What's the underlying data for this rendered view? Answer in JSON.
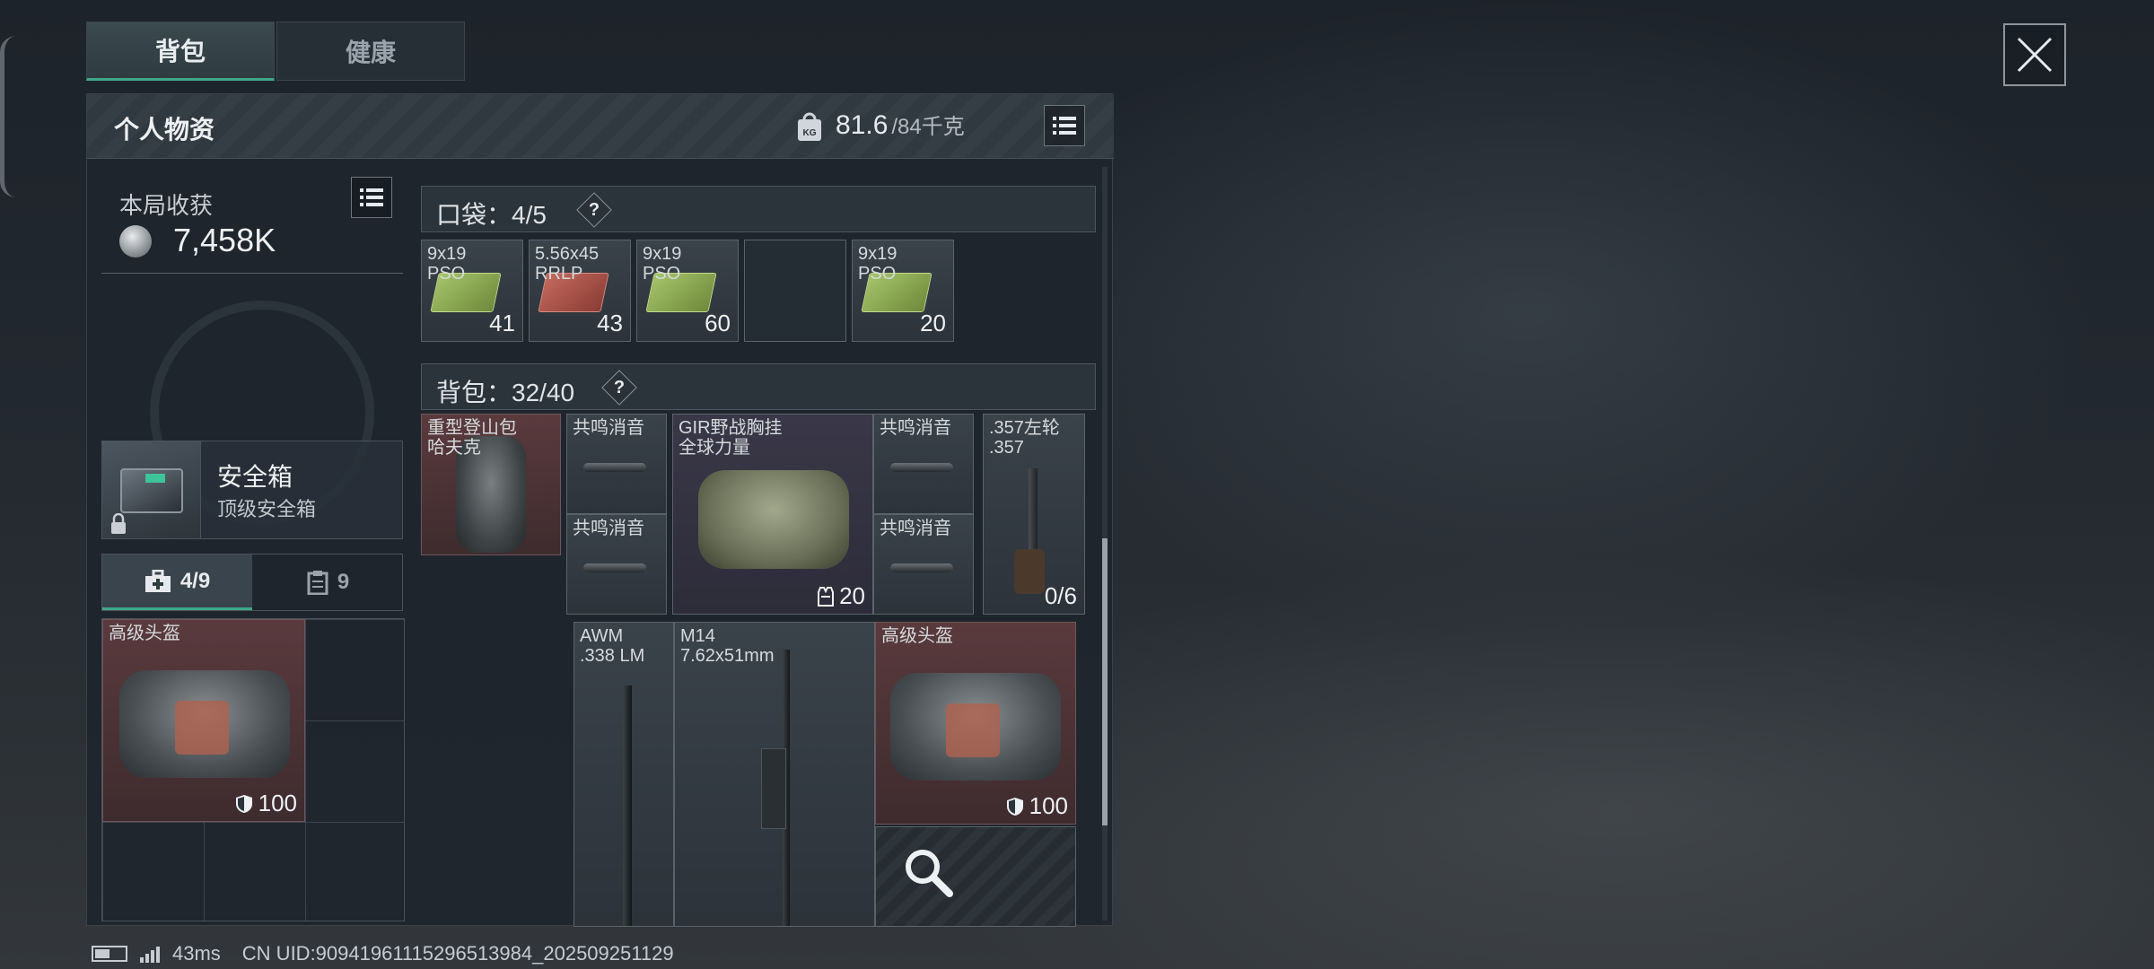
{
  "tabs": [
    {
      "label": "背包",
      "active": true
    },
    {
      "label": "健康",
      "active": false
    }
  ],
  "panel": {
    "title": "个人物资",
    "weight_current": "81.6",
    "weight_max": "/84千克",
    "weight_icon": "kg-weight-icon"
  },
  "earnings": {
    "label": "本局收获",
    "value": "7,458K"
  },
  "safe_box": {
    "title": "安全箱",
    "subtitle": "顶级安全箱"
  },
  "sub_tabs": [
    {
      "label": "4/9",
      "icon": "medkit-icon",
      "active": true
    },
    {
      "label": "9",
      "icon": "clipboard-icon",
      "active": false
    }
  ],
  "safe_items": [
    {
      "name": "高级头盔",
      "durability": "100"
    }
  ],
  "pockets": {
    "label": "口袋：4/5",
    "items": [
      {
        "name": "9x19\nPSO",
        "count": "41",
        "color": "green"
      },
      {
        "name": "5.56x45\nRRLP",
        "count": "43",
        "color": "red"
      },
      {
        "name": "9x19\nPSO",
        "count": "60",
        "color": "green"
      },
      {
        "name": "",
        "count": "",
        "color": "empty"
      },
      {
        "name": "9x19\nPSO",
        "count": "20",
        "color": "green"
      }
    ]
  },
  "backpack": {
    "label": "背包：32/40",
    "items": {
      "bag": {
        "name": "重型登山包\n哈夫克"
      },
      "suppressor_1": {
        "name": "共鸣消音"
      },
      "suppressor_2": {
        "name": "共鸣消音"
      },
      "suppressor_3": {
        "name": "共鸣消音"
      },
      "suppressor_4": {
        "name": "共鸣消音"
      },
      "chest_rig": {
        "name": "GIR野战胸挂\n全球力量",
        "count": "20"
      },
      "revolver": {
        "name": ".357左轮\n.357",
        "count": "0/6"
      },
      "awm": {
        "name": "AWM\n.338 LM"
      },
      "m14": {
        "name": "M14\n7.62x51mm"
      },
      "helmet": {
        "name": "高级头盔",
        "durability": "100"
      }
    }
  },
  "status": {
    "ping": "43ms",
    "uid": "CN UID:909419611152965139​84_202509251129"
  },
  "colors": {
    "accent": "#3ea88a",
    "red_rarity": "#5a3a3d",
    "purple_rarity": "#3a3848"
  }
}
